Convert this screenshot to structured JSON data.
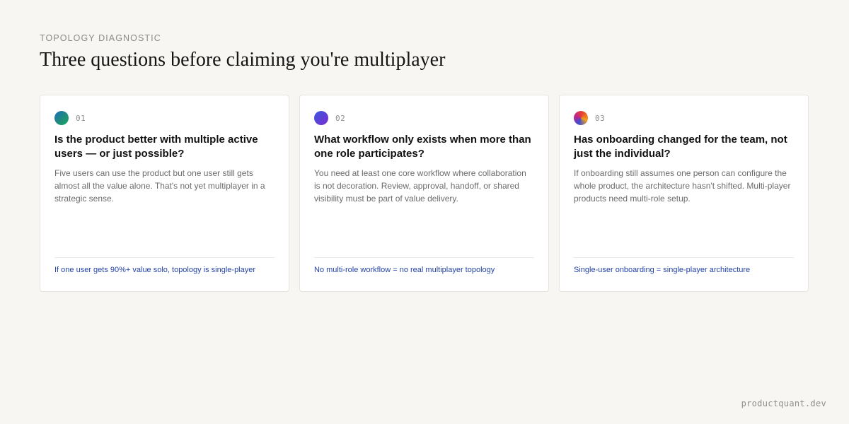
{
  "header": {
    "eyebrow": "TOPOLOGY DIAGNOSTIC",
    "title": "Three questions before claiming you're multiplayer"
  },
  "cards": [
    {
      "number": "01",
      "icon": "gradient-dot-icon",
      "question": "Is the product better with multiple active users — or just possible?",
      "body": "Five users can use the product but one user still gets almost all the value alone. That's not yet multiplayer in a strategic sense.",
      "footnote": "If one user gets 90%+ value solo, topology is single-player"
    },
    {
      "number": "02",
      "icon": "gradient-dot-icon",
      "question": "What workflow only exists when more than one role participates?",
      "body": "You need at least one core workflow where collaboration is not decoration. Review, approval, handoff, or shared visibility must be part of value delivery.",
      "footnote": "No multi-role workflow = no real multiplayer topology"
    },
    {
      "number": "03",
      "icon": "gradient-dot-icon",
      "question": "Has onboarding changed for the team, not just the individual?",
      "body": "If onboarding still assumes one person can configure the whole product, the architecture hasn't shifted. Multi-player products need multi-role setup.",
      "footnote": "Single-user onboarding = single-player architecture"
    }
  ],
  "footer": {
    "credit": "productquant.dev"
  },
  "colors": {
    "background": "#f7f6f2",
    "card": "#ffffff",
    "accent_link": "#2443a8",
    "muted": "#6b6b6b"
  }
}
